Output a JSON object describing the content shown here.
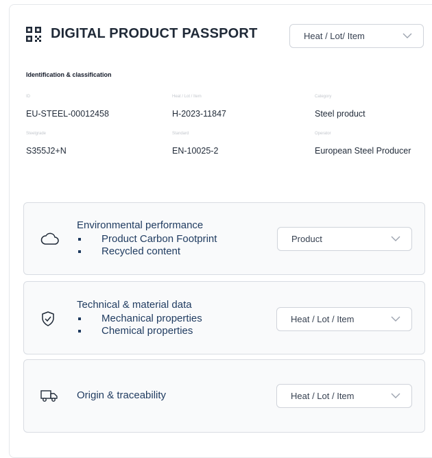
{
  "header": {
    "title": "DIGITAL PRODUCT PASSPORT",
    "selector": "Heat / Lot/ Item"
  },
  "identification": {
    "heading": "Identification & classification",
    "fields": [
      {
        "label": "ID",
        "value": "EU-STEEL-00012458"
      },
      {
        "label": "Heat / Lot / Item",
        "value": "H-2023-11847"
      },
      {
        "label": "Category",
        "value": "Steel product"
      },
      {
        "label": "Steelgrade",
        "value": "S355J2+N"
      },
      {
        "label": "Standard",
        "value": "EN-10025-2"
      },
      {
        "label": "Operator",
        "value": "European Steel Producer"
      }
    ]
  },
  "panels": [
    {
      "title": "Environmental performance",
      "items": [
        "Product Carbon Footprint",
        "Recycled content"
      ],
      "selector": "Product",
      "icon": "cloud-icon"
    },
    {
      "title": "Technical & material data",
      "items": [
        "Mechanical properties",
        "Chemical properties"
      ],
      "selector": "Heat / Lot / Item",
      "icon": "shield-check-icon"
    },
    {
      "title": "Origin & traceability",
      "items": [],
      "selector": "Heat / Lot / Item",
      "icon": "truck-icon"
    }
  ],
  "colors": {
    "accent": "#1e3a5f",
    "border": "#d8dce2",
    "panel_bg": "#f9fafb"
  }
}
